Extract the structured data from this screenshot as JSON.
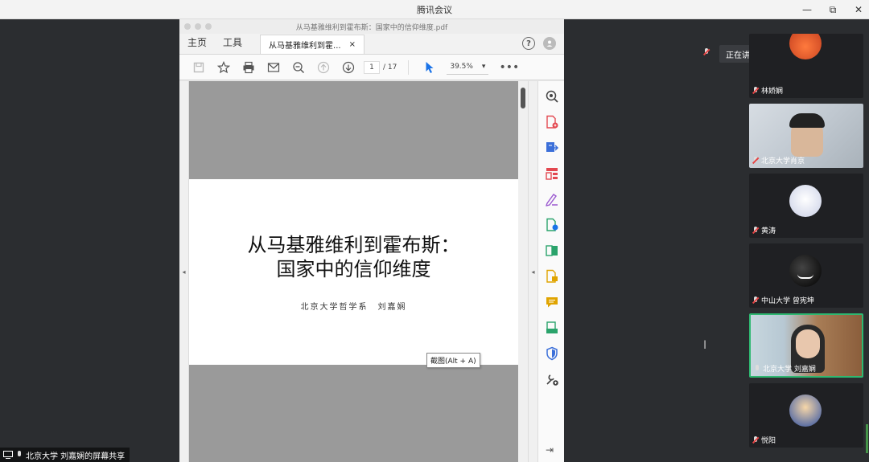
{
  "app": {
    "title": "腾讯会议",
    "controls": [
      "—",
      "⧉",
      "✕"
    ]
  },
  "acrobat": {
    "window_title": "从马基雅维利到霍布斯：国家中的信仰维度.pdf",
    "menu_home": "主页",
    "menu_tools": "工具",
    "doc_tab": "从马基雅维利到霍...",
    "doc_tab_close": "×",
    "help": "?",
    "page_current": "1",
    "page_total": "/ 17",
    "zoom": "39.5%",
    "zoom_caret": "▾",
    "more": "•••",
    "left_arrow": "◂",
    "right_arrow": "◂",
    "collapse_icon": "⇥"
  },
  "pdf_page": {
    "title_line1": "从马基雅维利到霍布斯：",
    "title_line2": "国家中的信仰维度",
    "author": "北京大学哲学系　刘嘉娴"
  },
  "tooltip": "截图(Alt + A)",
  "speaking": "正在讲话：北京大学 刘嘉娴；",
  "participants": [
    {
      "name": "林娇娴",
      "muted": true
    },
    {
      "name": "北京大学肖京",
      "muted": true
    },
    {
      "name": "黄涛",
      "muted": true
    },
    {
      "name": "中山大学 曾宪坤",
      "muted": true
    },
    {
      "name": "北京大学 刘嘉娴",
      "muted": false
    },
    {
      "name": "悦阳",
      "muted": true
    }
  ],
  "share_label": "北京大学 刘嘉娴的屏幕共享",
  "colors": {
    "active_border": "#2eb871",
    "stage_bg": "#2b2d30"
  }
}
